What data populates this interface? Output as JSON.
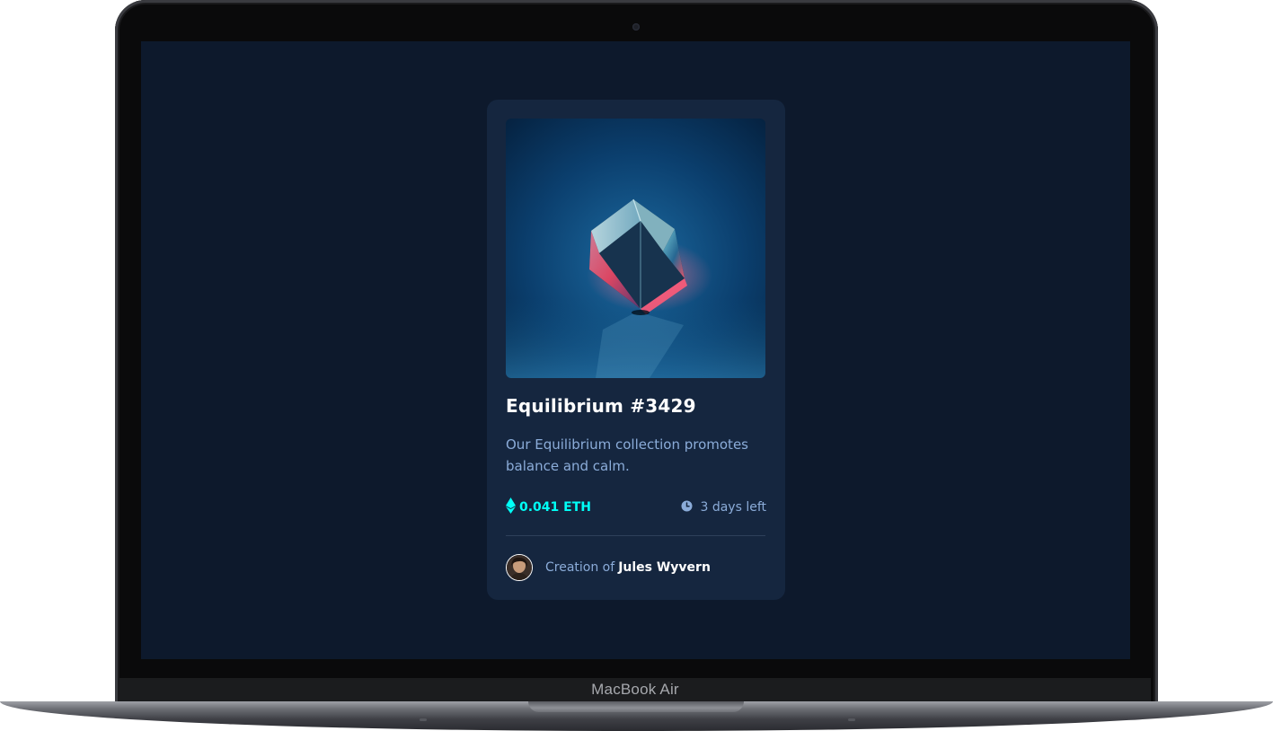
{
  "device": {
    "brand_label": "MacBook Air"
  },
  "card": {
    "image_alt": "glowing cube on blue background",
    "title": "Equilibrium #3429",
    "description": "Our Equilibrium collection promotes balance and calm.",
    "price": "0.041 ETH",
    "time_left": "3 days left",
    "creator_prefix": "Creation of",
    "creator_name": "Jules Wyvern"
  },
  "colors": {
    "screen_bg": "#0d192c",
    "card_bg": "#15263f",
    "accent_cyan": "#00fff7",
    "soft_blue": "#8bacd9",
    "white": "#ffffff"
  },
  "icons": {
    "price": "ethereum-icon",
    "time": "clock-icon"
  }
}
